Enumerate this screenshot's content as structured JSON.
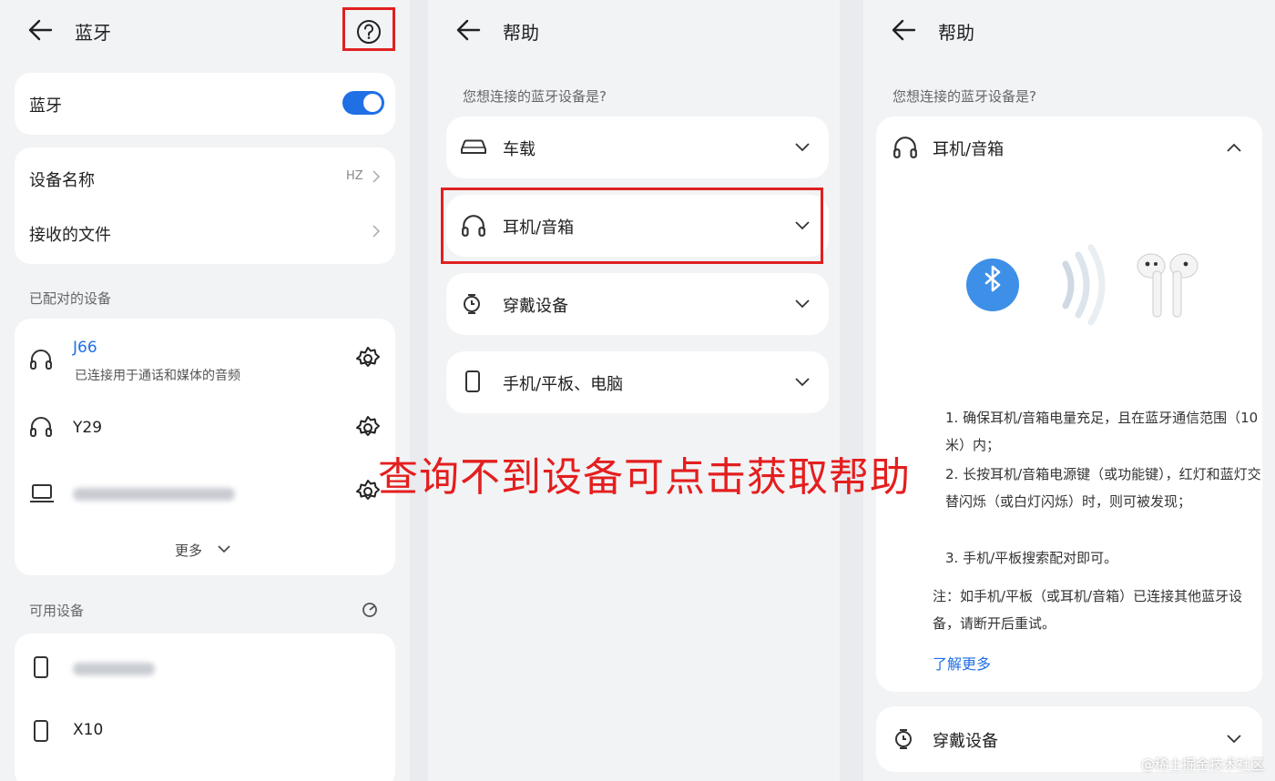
{
  "bt_settings": {
    "title": "蓝牙",
    "bluetooth_label": "蓝牙",
    "bluetooth_on": true,
    "device_name_label": "设备名称",
    "device_name_value": "HZ",
    "received_files_label": "接收的文件",
    "paired_header": "已配对的设备",
    "paired": [
      {
        "name": "J66",
        "status": "已连接用于通话和媒体的音频",
        "icon": "headphones-icon"
      },
      {
        "name": "Y29",
        "icon": "headphones-icon"
      },
      {
        "name": "",
        "icon": "laptop-icon"
      }
    ],
    "more_label": "更多",
    "available_header": "可用设备",
    "available": [
      {
        "name": "",
        "icon": "phone-icon"
      },
      {
        "name": "X10",
        "icon": "phone-icon"
      }
    ]
  },
  "help1": {
    "title": "帮助",
    "question": "您想连接的蓝牙设备是?",
    "items": [
      {
        "label": "车载",
        "icon": "car-icon"
      },
      {
        "label": "耳机/音箱",
        "icon": "headphones-icon"
      },
      {
        "label": "穿戴设备",
        "icon": "watch-icon"
      },
      {
        "label": "手机/平板、电脑",
        "icon": "phone-icon"
      }
    ]
  },
  "help2": {
    "title": "帮助",
    "question": "您想连接的蓝牙设备是?",
    "expanded_label": "耳机/音箱",
    "steps": [
      "1. 确保耳机/音箱电量充足，且在蓝牙通信范围（10 米）内；",
      "2. 长按耳机/音箱电源键（或功能键），红灯和蓝灯交替闪烁（或白灯闪烁）时，则可被发现；",
      "3. 手机/平板搜索配对即可。",
      "注：如手机/平板（或耳机/音箱）已连接其他蓝牙设备，请断开后重试。"
    ],
    "learn_more": "了解更多",
    "next_item": "穿戴设备"
  },
  "overlay_text": "查询不到设备可点击获取帮助",
  "watermark": "@稀土掘金技术社区",
  "colors": {
    "accent": "#1f6fe5",
    "highlight": "#e02020",
    "bt_blue": "#3d8fe8"
  }
}
